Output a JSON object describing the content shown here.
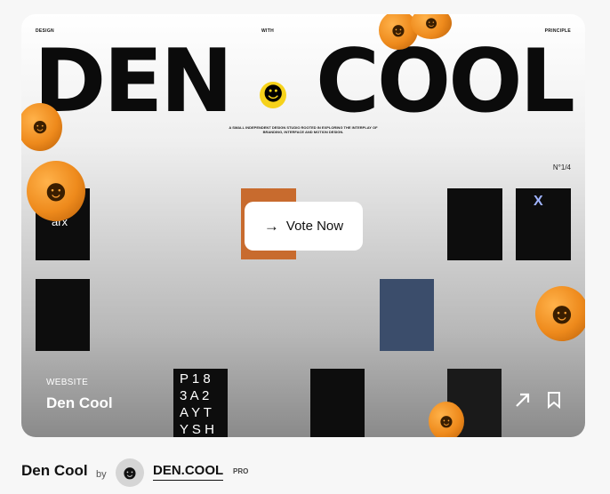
{
  "card": {
    "top_labels": {
      "left": "DESIGN",
      "center": "WITH",
      "right": "PRINCIPLE"
    },
    "headline_left": "DEN",
    "headline_right": "COOL",
    "smiley": "☻",
    "tagline": "A SMALL INDEPENDENT DESIGN STUDIO ROOTED IN EXPLORING THE INTERPLAY OF BRANDING, INTERFACE AND MOTION DESIGN.",
    "counter": "N°1/4",
    "tile_text": {
      "arx": "arx",
      "x_badge": "X",
      "grid_letters": [
        "P 1 8",
        "3 A 2",
        "A Y T",
        "Y S H"
      ]
    },
    "vote_button": {
      "icon": "→",
      "label": "Vote Now"
    },
    "category": "WEBSITE",
    "title": "Den Cool",
    "icons": {
      "open": "arrow-up-right-icon",
      "save": "bookmark-icon"
    }
  },
  "footer": {
    "title": "Den Cool",
    "by": "by",
    "author": "DEN.COOL",
    "badge": "PRO"
  }
}
